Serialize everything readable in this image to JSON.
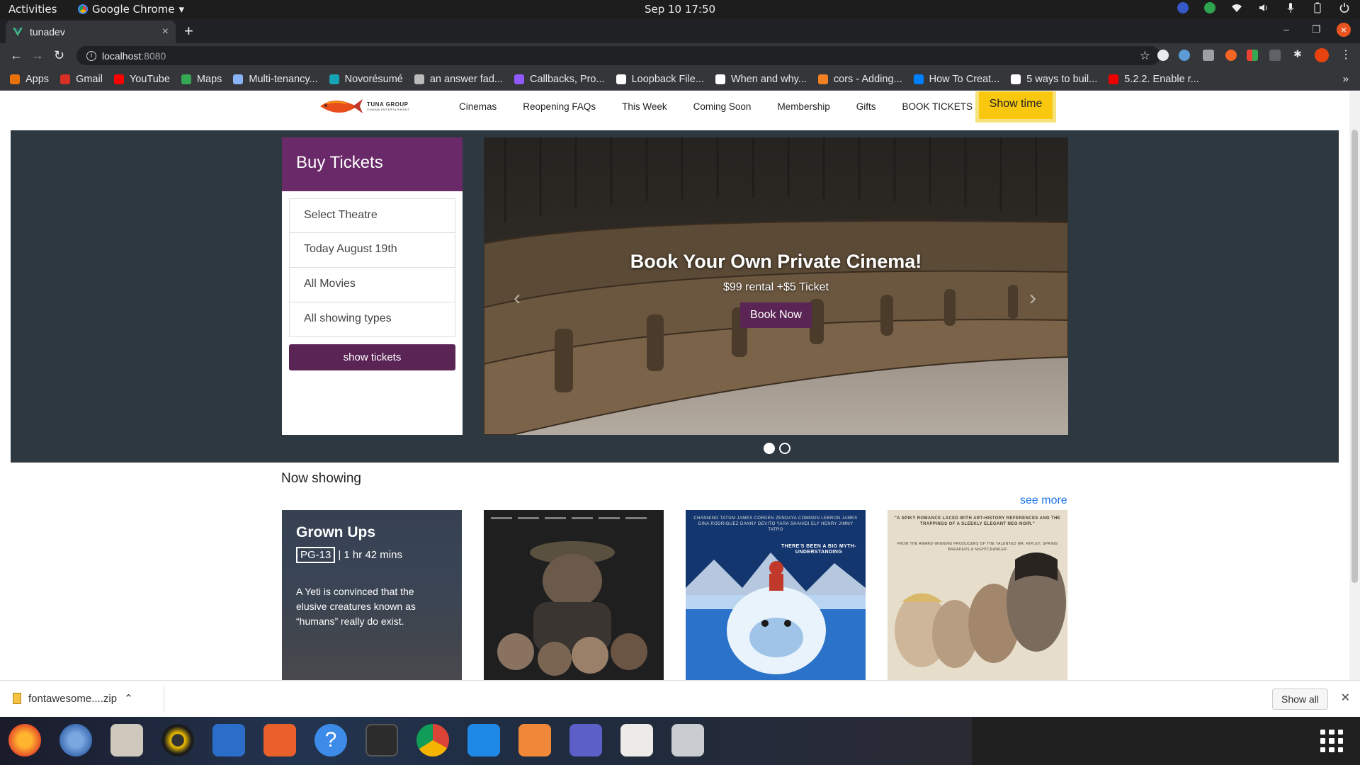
{
  "topbar": {
    "activities": "Activities",
    "app_name": "Google Chrome",
    "clock": "Sep 10  17:50"
  },
  "browser": {
    "tab_title": "tunadev",
    "url_host": "localhost",
    "url_port": ":8080",
    "bookmarks": [
      {
        "label": "Apps",
        "icon": "apps-grid-icon",
        "color": "#e8710a"
      },
      {
        "label": "Gmail",
        "icon": "gmail-icon",
        "color": "#d93025"
      },
      {
        "label": "YouTube",
        "icon": "youtube-icon",
        "color": "#ff0000"
      },
      {
        "label": "Maps",
        "icon": "maps-pin-icon",
        "color": "#34a853"
      },
      {
        "label": "Multi-tenancy...",
        "icon": "plane-icon",
        "color": "#8ab4f8"
      },
      {
        "label": "Novorésumé",
        "icon": "novoresume-icon",
        "color": "#16a3b6"
      },
      {
        "label": "an answer fad...",
        "icon": "globe-icon",
        "color": "#bbbbbb"
      },
      {
        "label": "Callbacks, Pro...",
        "icon": "firefox-dev-icon",
        "color": "#9059ff"
      },
      {
        "label": "Loopback File...",
        "icon": "medium-icon",
        "color": "#ffffff"
      },
      {
        "label": "When and why...",
        "icon": "medium-icon",
        "color": "#ffffff"
      },
      {
        "label": "cors - Adding...",
        "icon": "stackoverflow-icon",
        "color": "#f48024"
      },
      {
        "label": "How To Creat...",
        "icon": "digitalocean-icon",
        "color": "#0080ff"
      },
      {
        "label": "5 ways to buil...",
        "icon": "a-icon",
        "color": "#ffffff"
      },
      {
        "label": "5.2.2. Enable r...",
        "icon": "redhat-icon",
        "color": "#ee0000"
      }
    ],
    "bookmarks_more": "»"
  },
  "site": {
    "logo_text": "TUNA GROUP",
    "logo_sub": "CINEMA ENTERTAINMENT",
    "menu": [
      "Cinemas",
      "Reopening FAQs",
      "This Week",
      "Coming Soon",
      "Membership",
      "Gifts",
      "BOOK TICKETS"
    ],
    "showtime_label": "Show time",
    "buy": {
      "heading": "Buy Tickets",
      "fields": [
        "Select Theatre",
        "Today August 19th",
        "All Movies",
        "All showing types"
      ],
      "button": "show tickets"
    },
    "slide": {
      "title": "Book Your Own Private Cinema!",
      "subtitle": "$99 rental +$5 Ticket",
      "cta": "Book Now",
      "prev": "‹",
      "next": "›",
      "active_index": 0,
      "count": 2
    },
    "now_showing": {
      "heading": "Now showing",
      "see_more": "see more",
      "featured": {
        "title": "Grown Ups",
        "rating": "PG-13",
        "duration": "| 1 hr 42 mins",
        "description": "A Yeti is convinced that the elusive creatures known as “humans” really do exist."
      },
      "poster3_cast": "CHANNING TATUM  JAMES CORDEN  ZENDAYA  COMMON  LEBRON JAMES GINA RODRIGUEZ  DANNY DEVITO  YARA SHAHIDI  ELY HENRY  JIMMY TATRO",
      "poster3_tag": "THERE'S BEEN A BIG MYTH-UNDERSTANDING",
      "poster4_quote": "\"A SPIKY ROMANCE LACED WITH ART-HISTORY REFERENCES AND THE TRAPPINGS OF A SLEEKLY ELEGANT NEO-NOIR.\"",
      "poster4_credit": "FROM THE AWARD-WINNING PRODUCERS OF THE TALENTED MR. RIPLEY, SPRING BREAKERS & NIGHTCRAWLER"
    }
  },
  "download_bar": {
    "file": "fontawesome....zip",
    "show_all": "Show all"
  }
}
